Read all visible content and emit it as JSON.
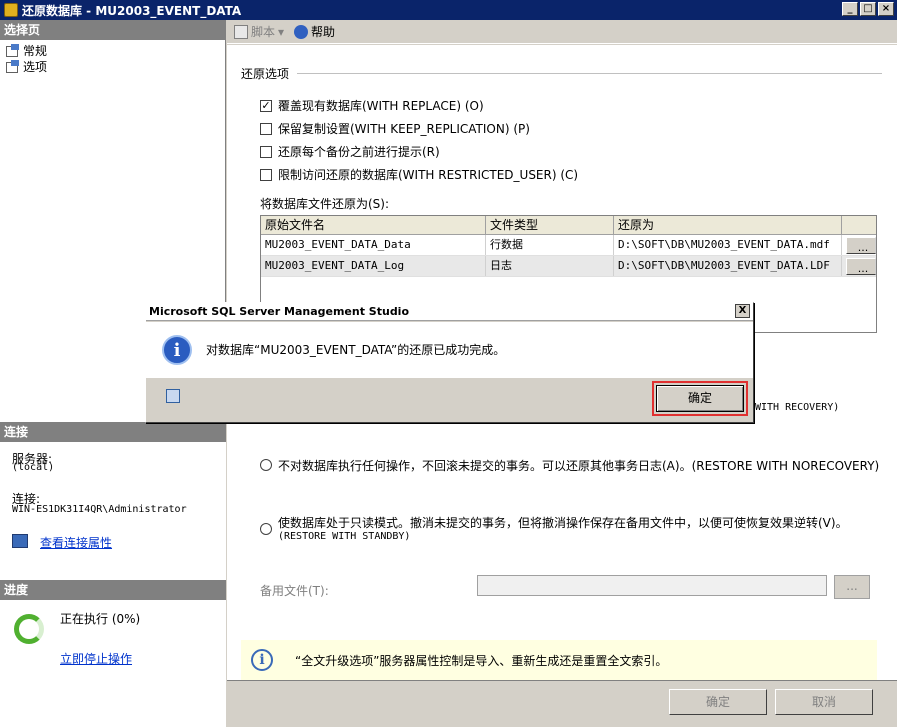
{
  "window": {
    "title": "还原数据库 - MU2003_EVENT_DATA"
  },
  "left": {
    "select_page_header": "选择页",
    "pages": [
      {
        "label": "常规"
      },
      {
        "label": "选项"
      }
    ],
    "connection_header": "连接",
    "server_label": "服务器:",
    "server_value": "(local)",
    "connection_label": "连接:",
    "connection_value": "WIN-ES1DK31I4QR\\Administrator",
    "view_connection_link": "查看连接属性",
    "progress_header": "进度",
    "progress_status": "正在执行 (0%)",
    "stop_link": "立即停止操作"
  },
  "toolbar": {
    "script_label": "脚本",
    "help_label": "帮助"
  },
  "options": {
    "group_title": "还原选项",
    "checks": [
      {
        "label": "覆盖现有数据库(WITH REPLACE) (O)",
        "checked": true
      },
      {
        "label": "保留复制设置(WITH KEEP_REPLICATION) (P)",
        "checked": false
      },
      {
        "label": "还原每个备份之前进行提示(R)",
        "checked": false
      },
      {
        "label": "限制访问还原的数据库(WITH RESTRICTED_USER) (C)",
        "checked": false
      }
    ],
    "files_label": "将数据库文件还原为(S):",
    "grid_headers": [
      "原始文件名",
      "文件类型",
      "还原为"
    ],
    "files": [
      {
        "name": "MU2003_EVENT_DATA_Data",
        "type": "行数据",
        "restore_as": "D:\\SOFT\\DB\\MU2003_EVENT_DATA.mdf",
        "browse": "..."
      },
      {
        "name": "MU2003_EVENT_DATA_Log",
        "type": "日志",
        "restore_as": "D:\\SOFT\\DB\\MU2003_EVENT_DATA.LDF",
        "browse": "..."
      }
    ],
    "recovery_trunc": "WITH RECOVERY)",
    "radio_norecovery": "不对数据库执行任何操作，不回滚未提交的事务。可以还原其他事务日志(A)。(RESTORE WITH NORECOVERY)",
    "radio_standby_line1": "使数据库处于只读模式。撤消未提交的事务，但将撤消操作保存在备用文件中，以便可使恢复效果逆转(V)。",
    "radio_standby_line2": "(RESTORE WITH STANDBY)",
    "standby_file_label": "备用文件(T):",
    "standby_browse": "...",
    "info_text": "“全文升级选项”服务器属性控制是导入、重新生成还是重置全文索引。"
  },
  "buttons": {
    "ok": "确定",
    "cancel": "取消"
  },
  "msgbox": {
    "title": "Microsoft SQL Server Management Studio",
    "message": "对数据库“MU2003_EVENT_DATA”的还原已成功完成。",
    "ok": "确定",
    "close": "X"
  }
}
